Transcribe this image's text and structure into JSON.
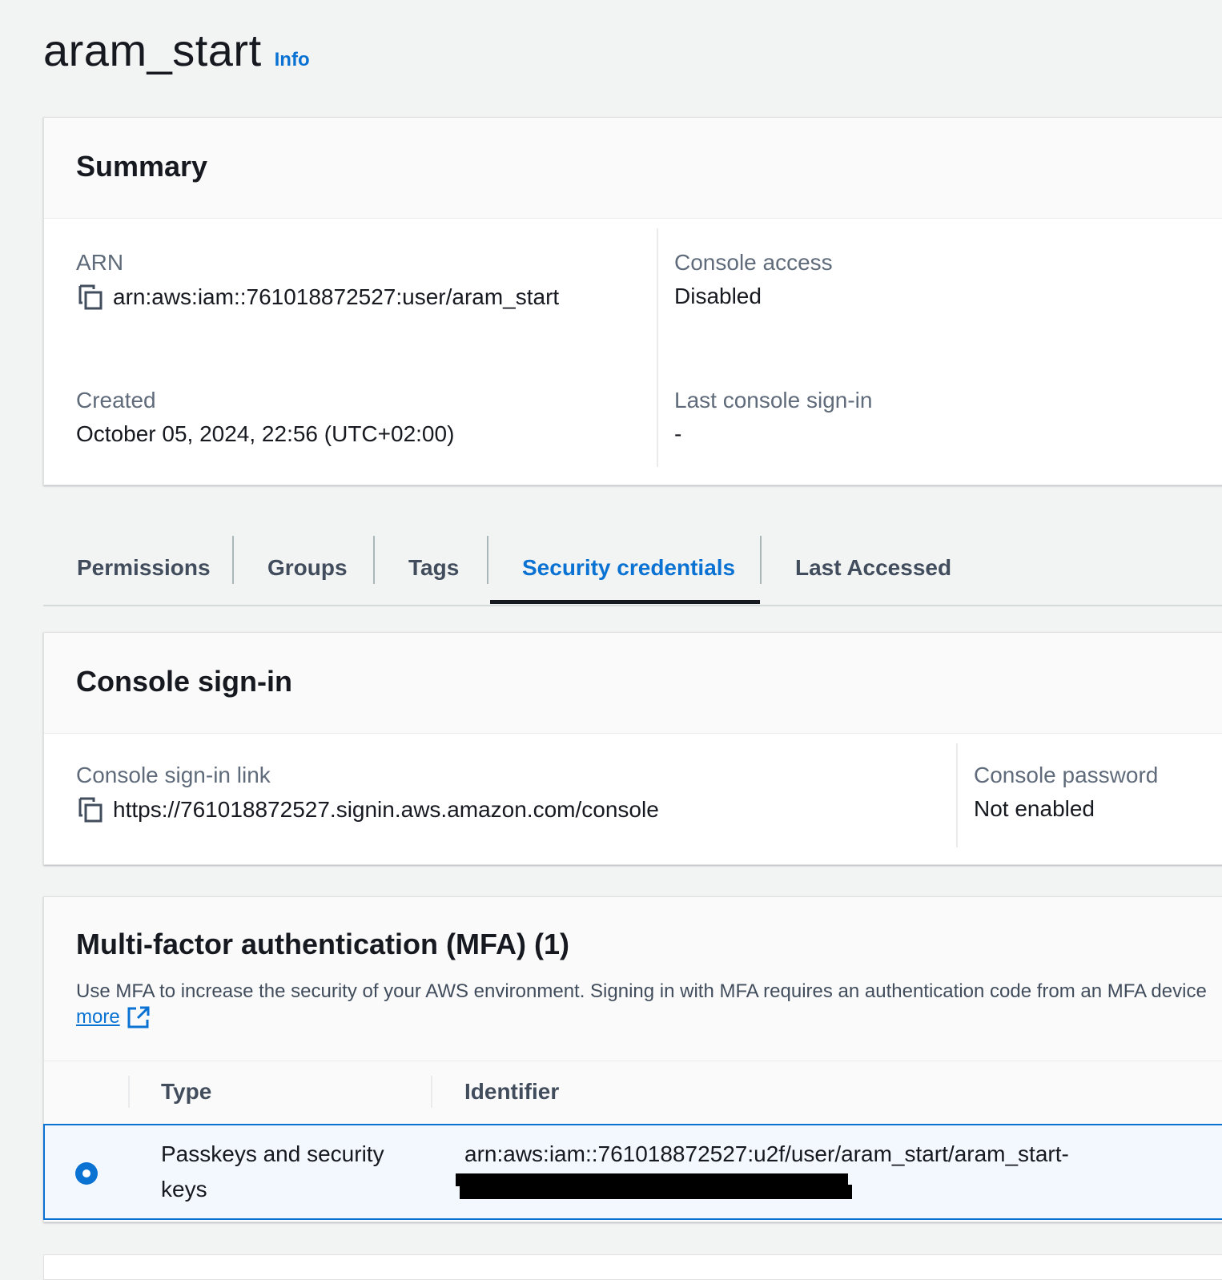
{
  "page": {
    "title": "aram_start",
    "info_label": "Info"
  },
  "summary": {
    "title": "Summary",
    "arn_label": "ARN",
    "arn_value": "arn:aws:iam::761018872527:user/aram_start",
    "console_access_label": "Console access",
    "console_access_value": "Disabled",
    "created_label": "Created",
    "created_value": "October 05, 2024, 22:56 (UTC+02:00)",
    "last_signin_label": "Last console sign-in",
    "last_signin_value": "-"
  },
  "tabs": [
    {
      "label": "Permissions"
    },
    {
      "label": "Groups"
    },
    {
      "label": "Tags"
    },
    {
      "label": "Security credentials",
      "active": true
    },
    {
      "label": "Last Accessed"
    }
  ],
  "console_signin": {
    "title": "Console sign-in",
    "link_label": "Console sign-in link",
    "link_value": "https://761018872527.signin.aws.amazon.com/console",
    "password_label": "Console password",
    "password_value": "Not enabled"
  },
  "mfa": {
    "title": "Multi-factor authentication (MFA) (1)",
    "description": "Use MFA to increase the security of your AWS environment. Signing in with MFA requires an authentication code from an MFA device",
    "learn_more": "more",
    "columns": [
      "Type",
      "Identifier"
    ],
    "rows": [
      {
        "type_line1": "Passkeys and security",
        "type_line2": "keys",
        "identifier": "arn:aws:iam::761018872527:u2f/user/aram_start/aram_start-",
        "selected": true
      }
    ]
  },
  "colors": {
    "accent": "#0972d3",
    "background": "#f2f3f3",
    "text": "#16191f",
    "muted": "#5f6b7a"
  }
}
